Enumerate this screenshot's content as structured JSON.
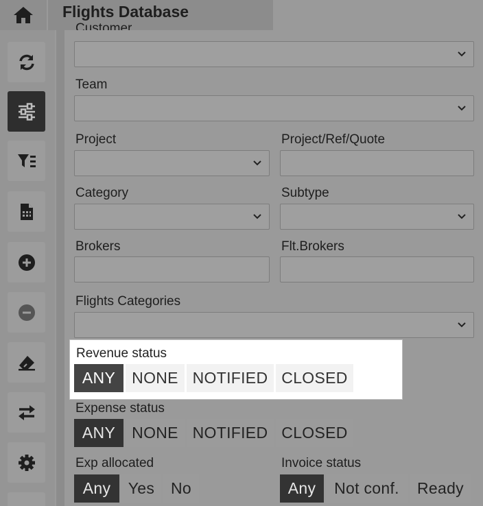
{
  "header": {
    "title": "Flights Database"
  },
  "sidebar": {
    "icons": [
      "home-icon",
      "refresh-icon",
      "sliders-icon",
      "filter-list-icon",
      "spreadsheet-icon",
      "plus-circle-icon",
      "minus-circle-icon",
      "eraser-icon",
      "swap-icon",
      "gear-icon"
    ]
  },
  "form": {
    "customer_label": "Customer",
    "team_label": "Team",
    "project_label": "Project",
    "project_ref_label": "Project/Ref/Quote",
    "category_label": "Category",
    "subtype_label": "Subtype",
    "brokers_label": "Brokers",
    "flt_brokers_label": "Flt.Brokers",
    "flights_categories_label": "Flights Categories"
  },
  "revenue_status": {
    "label": "Revenue status",
    "options": [
      "ANY",
      "NONE",
      "NOTIFIED",
      "CLOSED"
    ],
    "selected": "ANY"
  },
  "expense_status": {
    "label": "Expense status",
    "options": [
      "ANY",
      "NONE",
      "NOTIFIED",
      "CLOSED"
    ],
    "selected": "ANY"
  },
  "exp_allocated": {
    "label": "Exp allocated",
    "options": [
      "Any",
      "Yes",
      "No"
    ],
    "selected": "Any"
  },
  "invoice_status": {
    "label": "Invoice status",
    "options": [
      "Any",
      "Not conf.",
      "Ready"
    ],
    "selected": "Any"
  }
}
